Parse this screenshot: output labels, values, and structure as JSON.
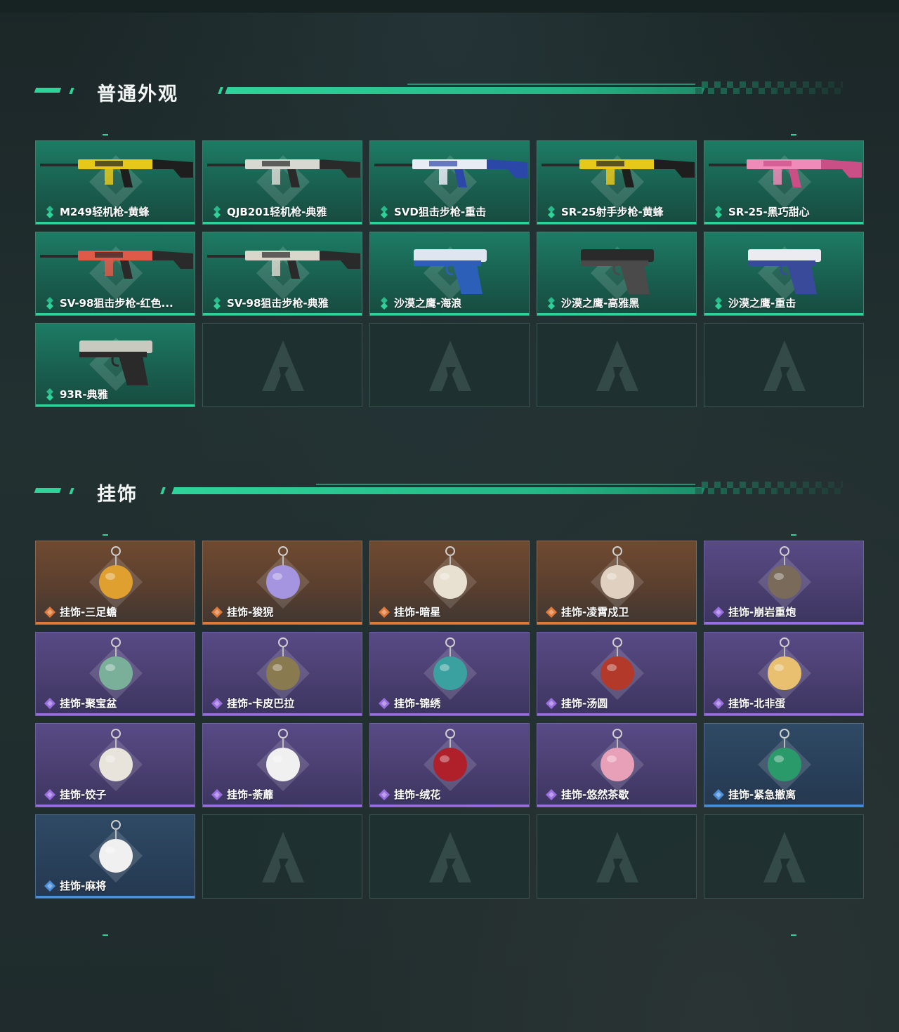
{
  "sections": [
    {
      "title": "普通外观",
      "items": [
        {
          "label": "M249轻机枪-黄蜂",
          "rarity": "green",
          "art": "rifle-yellow-icon"
        },
        {
          "label": "QJB201轻机枪-典雅",
          "rarity": "green",
          "art": "lmg-white-icon"
        },
        {
          "label": "SVD狙击步枪-重击",
          "rarity": "green",
          "art": "sniper-blue-icon"
        },
        {
          "label": "SR-25射手步枪-黄蜂",
          "rarity": "green",
          "art": "rifle-yellow-icon"
        },
        {
          "label": "SR-25-黑巧甜心",
          "rarity": "green",
          "art": "rifle-pink-icon"
        },
        {
          "label": "SV-98狙击步枪-红色...",
          "rarity": "green",
          "art": "sniper-red-icon"
        },
        {
          "label": "SV-98狙击步枪-典雅",
          "rarity": "green",
          "art": "sniper-white-icon"
        },
        {
          "label": "沙漠之鹰-海浪",
          "rarity": "green",
          "art": "pistol-blue-icon"
        },
        {
          "label": "沙漠之鹰-高雅黑",
          "rarity": "green",
          "art": "pistol-black-icon"
        },
        {
          "label": "沙漠之鹰-重击",
          "rarity": "green",
          "art": "pistol-white-icon"
        },
        {
          "label": "93R-典雅",
          "rarity": "green",
          "art": "pistol-camo-icon"
        }
      ]
    },
    {
      "title": "挂饰",
      "items": [
        {
          "label": "挂饰-三足蟾",
          "rarity": "orange",
          "art": "toad-charm-icon"
        },
        {
          "label": "挂饰-狻猊",
          "rarity": "orange",
          "art": "lion-charm-icon"
        },
        {
          "label": "挂饰-暗星",
          "rarity": "orange",
          "art": "feather-charm-icon"
        },
        {
          "label": "挂饰-凌霄戍卫",
          "rarity": "orange",
          "art": "rocket-charm-icon"
        },
        {
          "label": "挂饰-崩岩重炮",
          "rarity": "purple",
          "art": "rock-charm-icon"
        },
        {
          "label": "挂饰-聚宝盆",
          "rarity": "purple",
          "art": "bowl-charm-icon"
        },
        {
          "label": "挂饰-卡皮巴拉",
          "rarity": "purple",
          "art": "capybara-charm-icon"
        },
        {
          "label": "挂饰-锦绣",
          "rarity": "purple",
          "art": "butterfly-charm-icon"
        },
        {
          "label": "挂饰-汤圆",
          "rarity": "purple",
          "art": "dumpling-soup-charm-icon"
        },
        {
          "label": "挂饰-北非蛋",
          "rarity": "purple",
          "art": "egg-pan-charm-icon"
        },
        {
          "label": "挂饰-饺子",
          "rarity": "purple",
          "art": "dumpling-plate-charm-icon"
        },
        {
          "label": "挂饰-荼蘼",
          "rarity": "purple",
          "art": "flower-white-charm-icon"
        },
        {
          "label": "挂饰-绒花",
          "rarity": "purple",
          "art": "rose-charm-icon"
        },
        {
          "label": "挂饰-悠然茶歇",
          "rarity": "purple",
          "art": "cupcake-charm-icon"
        },
        {
          "label": "挂饰-紧急撤离",
          "rarity": "blue",
          "art": "sign-charm-icon"
        },
        {
          "label": "挂饰-麻将",
          "rarity": "blue",
          "art": "mahjong-charm-icon"
        }
      ]
    }
  ],
  "colors": {
    "accent": "#2fd39a",
    "green": "#2fd39a",
    "orange": "#e07a3a",
    "purple": "#9a6ee0",
    "blue": "#4a8fd8"
  }
}
